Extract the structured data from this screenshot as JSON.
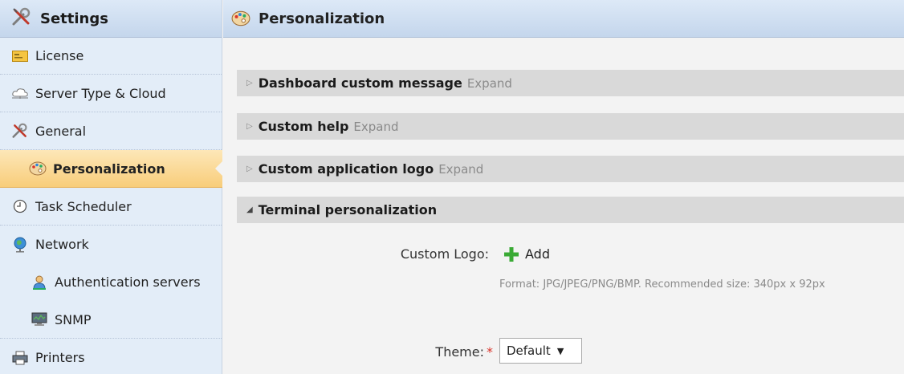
{
  "sidebar": {
    "title": "Settings",
    "items": [
      {
        "label": "License",
        "icon": "license-icon"
      },
      {
        "label": "Server Type & Cloud",
        "icon": "cloud-icon"
      },
      {
        "label": "General",
        "icon": "tools-icon"
      },
      {
        "label": "Personalization",
        "icon": "palette-icon",
        "selected": true
      },
      {
        "label": "Task Scheduler",
        "icon": "clock-icon"
      },
      {
        "label": "Network",
        "icon": "globe-icon"
      },
      {
        "label": "Authentication servers",
        "icon": "user-icon"
      },
      {
        "label": "SNMP",
        "icon": "monitor-icon"
      },
      {
        "label": "Printers",
        "icon": "printer-icon"
      }
    ]
  },
  "main": {
    "title": "Personalization",
    "sections": [
      {
        "title": "Dashboard custom message",
        "action": "Expand",
        "expanded": false
      },
      {
        "title": "Custom help",
        "action": "Expand",
        "expanded": false
      },
      {
        "title": "Custom application logo",
        "action": "Expand",
        "expanded": false
      },
      {
        "title": "Terminal personalization",
        "action": "",
        "expanded": true
      }
    ],
    "terminal": {
      "custom_logo_label": "Custom Logo:",
      "add_label": "Add",
      "format_hint": "Format: JPG/JPEG/PNG/BMP. Recommended size: 340px x 92px",
      "theme_label": "Theme:",
      "theme_required_mark": "*",
      "theme_value": "Default",
      "theme_caret": "▼"
    }
  },
  "colors": {
    "accent_selected": "#f8cd7a",
    "header_blue": "#c4d6ec",
    "required": "#d9342b",
    "add_green": "#3aaa35"
  }
}
